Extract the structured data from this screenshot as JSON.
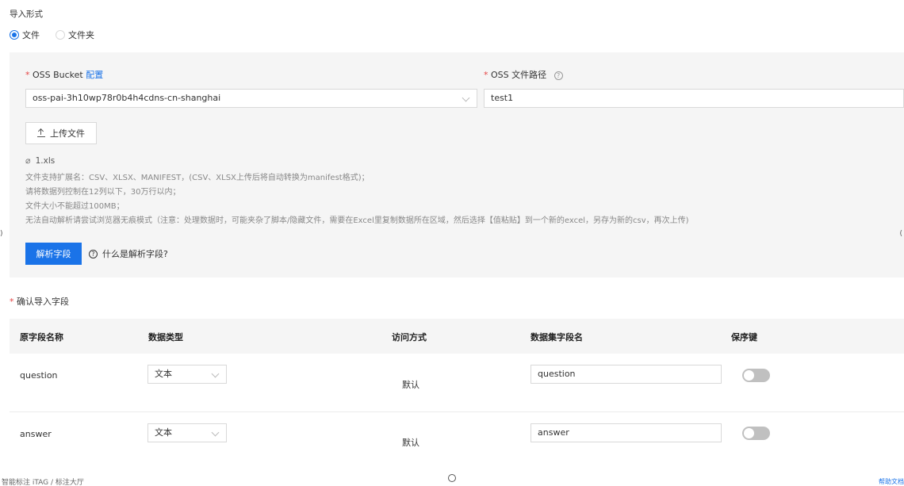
{
  "import_mode": {
    "label": "导入形式",
    "options": [
      {
        "label": "文件",
        "checked": true
      },
      {
        "label": "文件夹",
        "checked": false
      }
    ]
  },
  "oss_bucket": {
    "required_mark": "*",
    "label": "OSS Bucket",
    "config_link": "配置",
    "value": "oss-pai-3h10wp78r0b4h4cdns-cn-shanghai"
  },
  "oss_path": {
    "required_mark": "*",
    "label": "OSS 文件路径",
    "help_icon": "question-circle-icon",
    "value": "test1"
  },
  "upload": {
    "label": "上传文件",
    "icon": "upload-icon"
  },
  "file": {
    "icon": "paperclip-icon",
    "name": "1.xls"
  },
  "hints": [
    "文件支持扩展名：CSV、XLSX、MANIFEST，(CSV、XLSX上传后将自动转换为manifest格式)；",
    "请将数据列控制在12列以下，30万行以内；",
    "文件大小不能超过100MB；",
    "无法自动解析请尝试浏览器无痕模式（注意：处理数据时，可能夹杂了脚本/隐藏文件，需要在Excel里复制数据所在区域，然后选择【值粘贴】到一个新的excel，另存为新的csv，再次上传)"
  ],
  "parse": {
    "button_label": "解析字段",
    "help_text": "什么是解析字段?"
  },
  "confirm": {
    "required_mark": "*",
    "label": "确认导入字段"
  },
  "table": {
    "headers": [
      "原字段名称",
      "数据类型",
      "访问方式",
      "数据集字段名",
      "保序键"
    ],
    "rows": [
      {
        "source": "question",
        "type": "文本",
        "access": "默认",
        "field": "question",
        "ordered": false
      },
      {
        "source": "answer",
        "type": "文本",
        "access": "默认",
        "field": "answer",
        "ordered": false
      }
    ]
  },
  "footer": {
    "breadcrumb": "智能标注 iTAG / 标注大厅",
    "help": "帮助文档"
  },
  "colors": {
    "accent": "#1a73e8",
    "required": "#e54545",
    "panel_bg": "#f5f5f5"
  }
}
